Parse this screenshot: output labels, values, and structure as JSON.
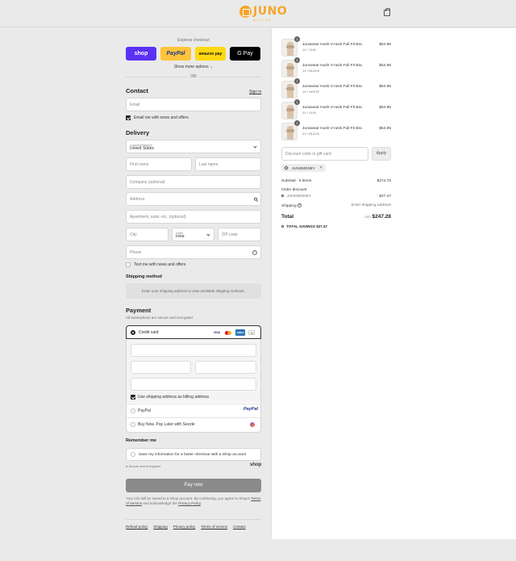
{
  "header": {
    "brand_name": "JUNO",
    "brand_sub": "ACTIVE",
    "brand_color": "#f4a52a",
    "cart_icon": "shopping-bag-icon"
  },
  "express": {
    "title": "Express checkout",
    "buttons": [
      "shop",
      "PayPal",
      "amazon pay",
      "G Pay"
    ],
    "more": "Show more options ⌄",
    "or": "OR"
  },
  "contact": {
    "heading": "Contact",
    "signin": "Sign in",
    "email_placeholder": "Email",
    "newsletter_label": "Email me with news and offers",
    "newsletter_checked": true
  },
  "delivery": {
    "heading": "Delivery",
    "country_label": "Country/Region",
    "country_value": "United States",
    "first_name": "First name",
    "last_name": "Last name",
    "company": "Company (optional)",
    "address": "Address",
    "apartment": "Apartment, suite, etc. (optional)",
    "city": "City",
    "state_label": "State",
    "state_value": "Iowa",
    "zip": "ZIP code",
    "phone": "Phone",
    "sms_label": "Text me with news and offers",
    "sms_checked": false
  },
  "shipping_method": {
    "heading": "Shipping method",
    "note": "Enter your shipping address to view available shipping methods."
  },
  "payment": {
    "heading": "Payment",
    "subtitle": "All transactions are secure and encrypted.",
    "credit_card_label": "Credit card",
    "card_brands": [
      "VISA",
      "MC",
      "AMEX"
    ],
    "more_brands": "+5",
    "billing_same_label": "Use shipping address as billing address",
    "billing_same_checked": true,
    "paypal_label": "PayPal",
    "paypal_logo": "PayPal",
    "sezzle_label": "Buy Now, Pay Later with Sezzle"
  },
  "remember": {
    "heading": "Remember me",
    "save_label": "Save my information for a faster checkout with a Shop account",
    "secure_label": "Secure and encrypted",
    "shop_logo": "shop"
  },
  "pay_now": "Pay now",
  "fineprint": {
    "text": "Your info will be saved to a Shop account. By continuing, you agree to Shop's",
    "terms": "Terms of Service",
    "and": "and acknowledge the",
    "privacy": "Privacy Policy",
    "period": "."
  },
  "footer_links": [
    "Refund policy",
    "Shipping",
    "Privacy policy",
    "Terms of service",
    "Contact"
  ],
  "cart": {
    "items": [
      {
        "qty": "1",
        "name": "Junowear Hush V-neck Full Fit Bra",
        "variant": "1X / SUN",
        "price": "$54.95"
      },
      {
        "qty": "1",
        "name": "Junowear Hush V-neck Full Fit Bra",
        "variant": "1X / BLACK",
        "price": "$54.95"
      },
      {
        "qty": "1",
        "name": "Junowear Hush V-neck Full Fit Bra",
        "variant": "1X / WHITE",
        "price": "$54.95"
      },
      {
        "qty": "1",
        "name": "Junowear Hush V-neck Full Fit Bra",
        "variant": "2X / SUN",
        "price": "$54.95"
      },
      {
        "qty": "1",
        "name": "Junowear Hush V-neck Full Fit Bra",
        "variant": "2X / BLACK",
        "price": "$54.95"
      }
    ],
    "discount_placeholder": "Discount code or gift card",
    "apply": "Apply",
    "applied_code": "JUNOMONEY",
    "subtotal_label": "Subtotal · 5 items",
    "subtotal_value": "$274.75",
    "order_discount_label": "Order discount",
    "order_discount_code": "JUNOMONEY",
    "order_discount_value": "- $27.47",
    "shipping_label": "Shipping",
    "shipping_value": "Enter shipping address",
    "total_label": "Total",
    "total_currency": "USD",
    "total_value": "$247.28",
    "savings_label": "TOTAL SAVINGS",
    "savings_value": "$27.47"
  }
}
